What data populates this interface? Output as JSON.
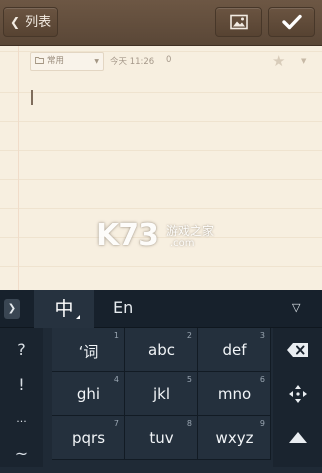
{
  "header": {
    "back_label": "列表",
    "back_icon": "chevron-left-icon",
    "image_icon": "image-icon",
    "confirm_icon": "checkmark-icon"
  },
  "note": {
    "folder": "常用",
    "time": "今天 11:26",
    "count": "0",
    "watermark_main": "K73",
    "watermark_sub": "游戏之家",
    "watermark_domain": ".com"
  },
  "keyboard": {
    "mode_chinese": "中",
    "mode_english": "En",
    "collapse_icon": "triangle-down-icon",
    "side_keys": [
      "?",
      "!",
      "...",
      "~"
    ],
    "keys": [
      {
        "num": "1",
        "label": "‘词"
      },
      {
        "num": "2",
        "label": "abc"
      },
      {
        "num": "3",
        "label": "def"
      },
      {
        "num": "4",
        "label": "ghi"
      },
      {
        "num": "5",
        "label": "jkl"
      },
      {
        "num": "6",
        "label": "mno"
      },
      {
        "num": "7",
        "label": "pqrs"
      },
      {
        "num": "8",
        "label": "tuv"
      },
      {
        "num": "9",
        "label": "wxyz"
      }
    ],
    "right_icons": [
      "backspace-icon",
      "move-cursor-icon",
      "shift-up-icon"
    ]
  },
  "colors": {
    "header_bg": "#5f4b3a",
    "paper_bg": "#f7efe0",
    "keyboard_bg": "#1f2a36"
  }
}
